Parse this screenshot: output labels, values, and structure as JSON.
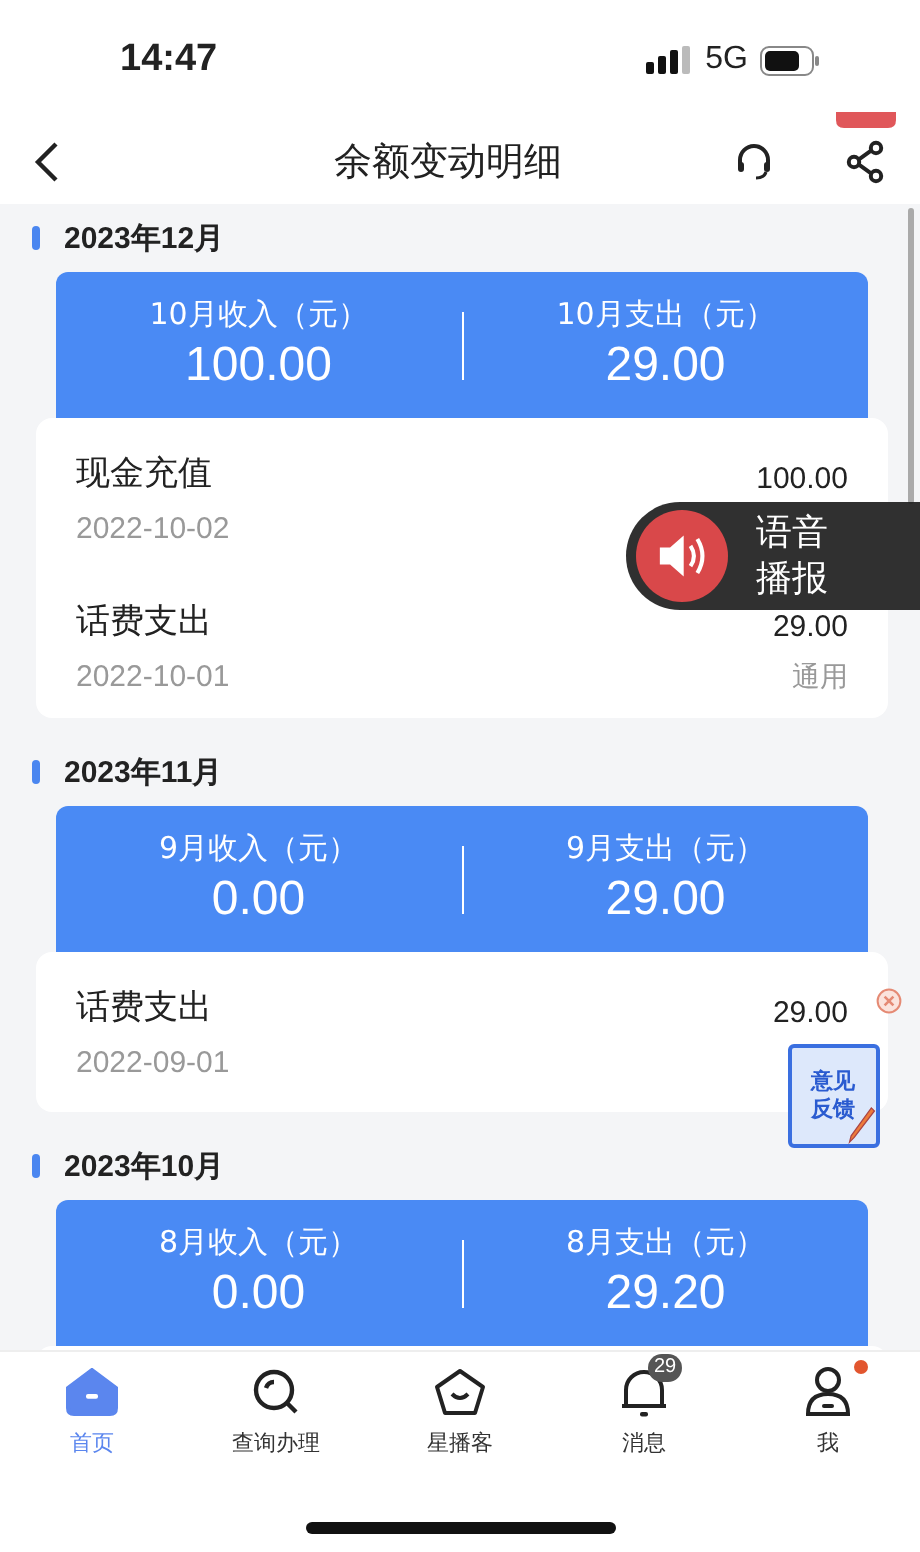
{
  "status_bar": {
    "time": "14:47",
    "network": "5G"
  },
  "header": {
    "title": "余额变动明细"
  },
  "sections": [
    {
      "month": "2023年12月",
      "income_label": "10月收入（元）",
      "income": "100.00",
      "expense_label": "10月支出（元）",
      "expense": "29.00",
      "records": [
        {
          "name": "现金充值",
          "date": "2022-10-02",
          "amount": "100.00"
        },
        {
          "name": "话费支出",
          "date": "2022-10-01",
          "amount": "29.00",
          "tag": "通用"
        }
      ]
    },
    {
      "month": "2023年11月",
      "income_label": "9月收入（元）",
      "income": "0.00",
      "expense_label": "9月支出（元）",
      "expense": "29.00",
      "records": [
        {
          "name": "话费支出",
          "date": "2022-09-01",
          "amount": "29.00"
        }
      ]
    },
    {
      "month": "2023年10月",
      "income_label": "8月收入（元）",
      "income": "0.00",
      "expense_label": "8月支出（元）",
      "expense": "29.20"
    }
  ],
  "voice_button": {
    "label": "语音播报"
  },
  "feedback": {
    "label": "意见反馈"
  },
  "tabs": [
    {
      "label": "首页",
      "selected": true
    },
    {
      "label": "查询办理",
      "selected": false
    },
    {
      "label": "星播客",
      "selected": false
    },
    {
      "label": "消息",
      "selected": false,
      "badge": "29"
    },
    {
      "label": "我",
      "selected": false,
      "dot": true
    }
  ]
}
